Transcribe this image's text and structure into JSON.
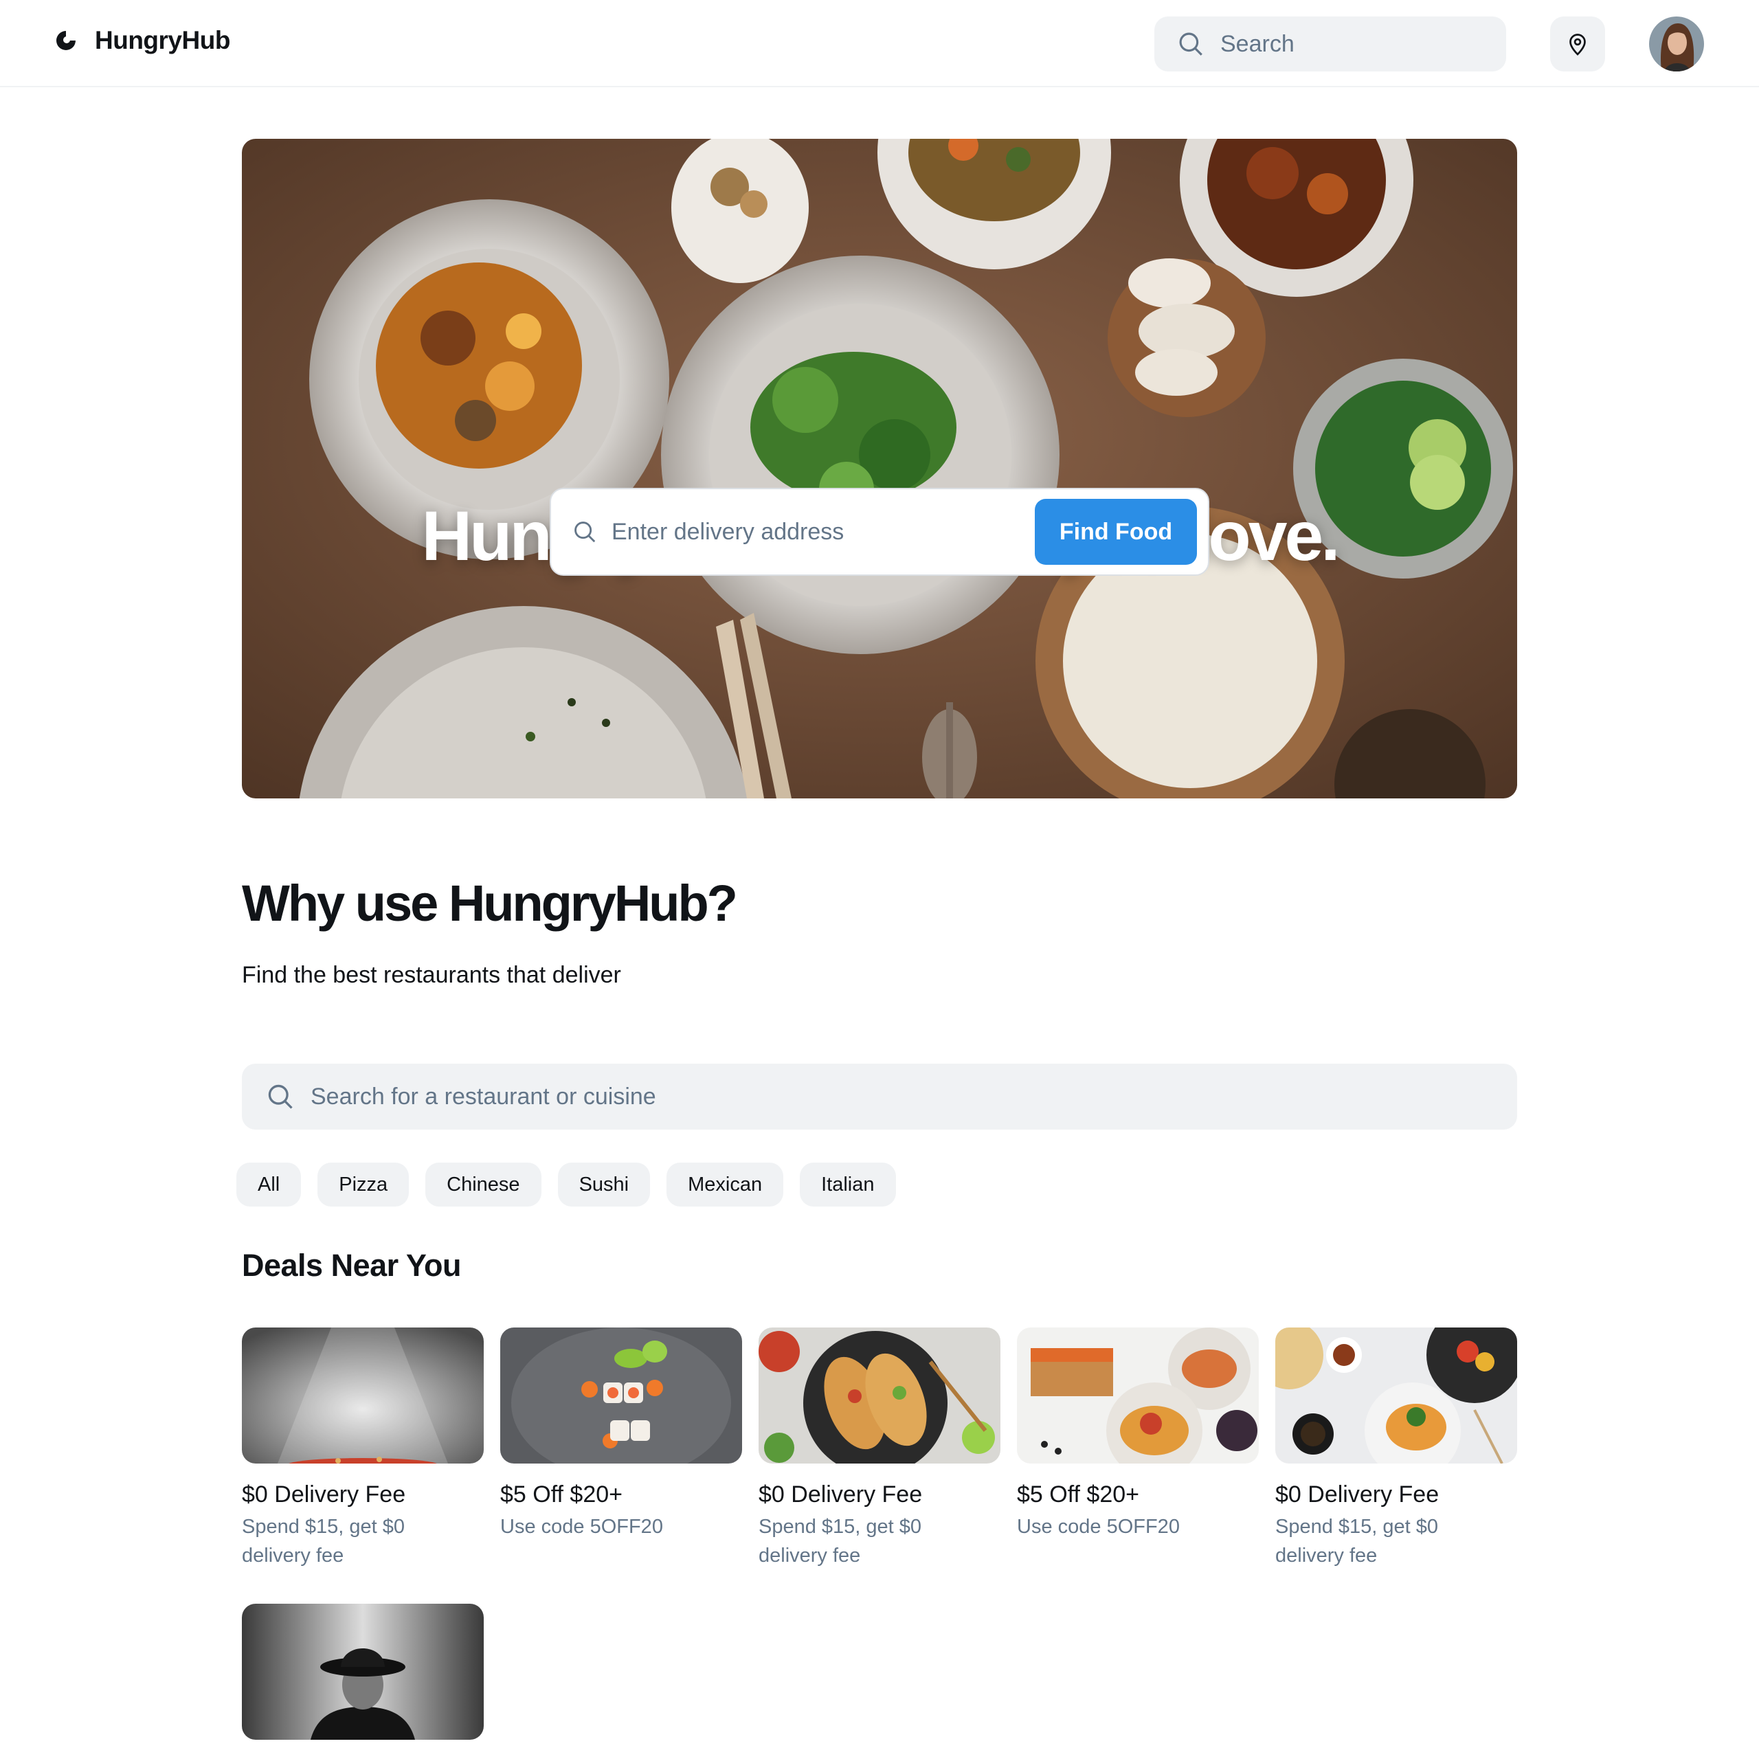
{
  "header": {
    "brand": "HungryHub",
    "search_placeholder": "Search"
  },
  "hero": {
    "title": "Hungry? Order food you love.",
    "address_placeholder": "Enter delivery address",
    "cta_label": "Find Food"
  },
  "why": {
    "title": "Why use HungryHub?",
    "subtitle": "Find the best restaurants that deliver"
  },
  "restaurant_search": {
    "placeholder": "Search for a restaurant or cuisine"
  },
  "categories": [
    "All",
    "Pizza",
    "Chinese",
    "Sushi",
    "Mexican",
    "Italian"
  ],
  "deals": {
    "title": "Deals Near You",
    "items": [
      {
        "title": "$0 Delivery Fee",
        "desc": "Spend $15, get $0 delivery fee"
      },
      {
        "title": "$5 Off $20+",
        "desc": "Use code 5OFF20"
      },
      {
        "title": "$0 Delivery Fee",
        "desc": "Spend $15, get $0 delivery fee"
      },
      {
        "title": "$5 Off $20+",
        "desc": "Use code 5OFF20"
      },
      {
        "title": "$0 Delivery Fee",
        "desc": "Spend $15, get $0 delivery fee"
      }
    ]
  },
  "colors": {
    "accent": "#2b8ee6",
    "text": "#111418",
    "muted": "#637588",
    "surface": "#f0f2f4"
  }
}
